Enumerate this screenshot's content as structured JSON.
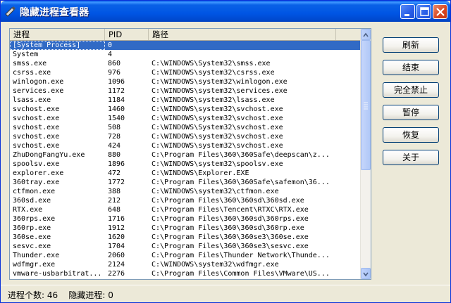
{
  "window": {
    "title": "隐藏进程查看器"
  },
  "columns": {
    "name": "进程",
    "pid": "PID",
    "path": "路径"
  },
  "rows": [
    {
      "name": "[System Process]",
      "pid": "0",
      "path": ""
    },
    {
      "name": "System",
      "pid": "4",
      "path": ""
    },
    {
      "name": "smss.exe",
      "pid": "860",
      "path": "C:\\WINDOWS\\System32\\smss.exe"
    },
    {
      "name": "csrss.exe",
      "pid": "976",
      "path": "C:\\WINDOWS\\system32\\csrss.exe"
    },
    {
      "name": "winlogon.exe",
      "pid": "1096",
      "path": "C:\\WINDOWS\\system32\\winlogon.exe"
    },
    {
      "name": "services.exe",
      "pid": "1172",
      "path": "C:\\WINDOWS\\system32\\services.exe"
    },
    {
      "name": "lsass.exe",
      "pid": "1184",
      "path": "C:\\WINDOWS\\system32\\lsass.exe"
    },
    {
      "name": "svchost.exe",
      "pid": "1460",
      "path": "C:\\WINDOWS\\system32\\svchost.exe"
    },
    {
      "name": "svchost.exe",
      "pid": "1540",
      "path": "C:\\WINDOWS\\system32\\svchost.exe"
    },
    {
      "name": "svchost.exe",
      "pid": "508",
      "path": "C:\\WINDOWS\\System32\\svchost.exe"
    },
    {
      "name": "svchost.exe",
      "pid": "728",
      "path": "C:\\WINDOWS\\system32\\svchost.exe"
    },
    {
      "name": "svchost.exe",
      "pid": "424",
      "path": "C:\\WINDOWS\\system32\\svchost.exe"
    },
    {
      "name": "ZhuDongFangYu.exe",
      "pid": "880",
      "path": "C:\\Program Files\\360\\360Safe\\deepscan\\z..."
    },
    {
      "name": "spoolsv.exe",
      "pid": "1896",
      "path": "C:\\WINDOWS\\system32\\spoolsv.exe"
    },
    {
      "name": "explorer.exe",
      "pid": "472",
      "path": "C:\\WINDOWS\\Explorer.EXE"
    },
    {
      "name": "360tray.exe",
      "pid": "1772",
      "path": "C:\\Program Files\\360\\360Safe\\safemon\\36..."
    },
    {
      "name": "ctfmon.exe",
      "pid": "388",
      "path": "C:\\WINDOWS\\system32\\ctfmon.exe"
    },
    {
      "name": "360sd.exe",
      "pid": "212",
      "path": "C:\\Program Files\\360\\360sd\\360sd.exe"
    },
    {
      "name": "RTX.exe",
      "pid": "648",
      "path": "C:\\Program Files\\Tencent\\RTXC\\RTX.exe"
    },
    {
      "name": "360rps.exe",
      "pid": "1716",
      "path": "C:\\Program Files\\360\\360sd\\360rps.exe"
    },
    {
      "name": "360rp.exe",
      "pid": "1912",
      "path": "C:\\Program Files\\360\\360sd\\360rp.exe"
    },
    {
      "name": "360se.exe",
      "pid": "1620",
      "path": "C:\\Program Files\\360\\360se3\\360se.exe"
    },
    {
      "name": "sesvc.exe",
      "pid": "1704",
      "path": "C:\\Program Files\\360\\360se3\\sesvc.exe"
    },
    {
      "name": "Thunder.exe",
      "pid": "2060",
      "path": "C:\\Program Files\\Thunder Network\\Thunde..."
    },
    {
      "name": "wdfmgr.exe",
      "pid": "2124",
      "path": "C:\\WINDOWS\\system32\\wdfmgr.exe"
    },
    {
      "name": "vmware-usbarbitrat...",
      "pid": "2276",
      "path": "C:\\Program Files\\Common Files\\VMware\\US..."
    }
  ],
  "buttons": [
    "刷新",
    "结束",
    "完全禁止",
    "暂停",
    "恢复",
    "关于"
  ],
  "status": {
    "process_count_label": "进程个数:",
    "process_count": "46",
    "hidden_label": "隐藏进程:",
    "hidden_count": "0"
  }
}
